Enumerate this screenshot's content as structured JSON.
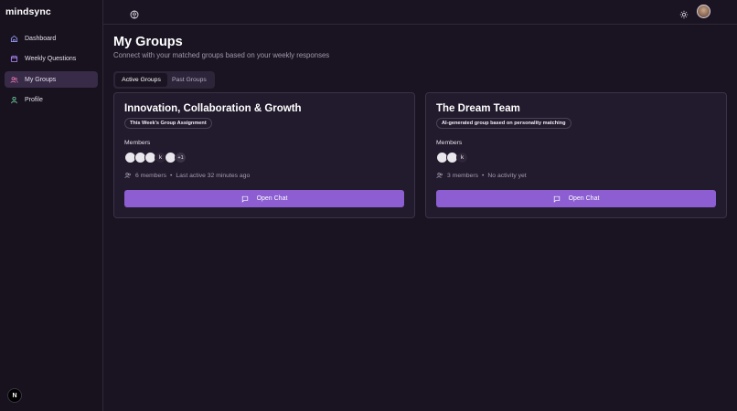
{
  "app": {
    "logo": "mindsync",
    "framework_badge": "N"
  },
  "sidebar": {
    "items": [
      {
        "label": "Dashboard",
        "icon": "home-icon",
        "active": false
      },
      {
        "label": "Weekly Questions",
        "icon": "calendar-icon",
        "active": false
      },
      {
        "label": "My Groups",
        "icon": "users-icon",
        "active": true
      },
      {
        "label": "Profile",
        "icon": "user-icon",
        "active": false
      }
    ]
  },
  "header": {
    "left_icon": "brain-icon",
    "theme_icon": "sun-icon",
    "avatar": "user-avatar"
  },
  "main": {
    "title": "My Groups",
    "subtitle": "Connect with your matched groups based on your weekly responses",
    "tabs": [
      {
        "label": "Active Groups",
        "active": true
      },
      {
        "label": "Past Groups",
        "active": false
      }
    ]
  },
  "groups": [
    {
      "name": "Innovation, Collaboration & Growth",
      "badge": "This Week's Group Assignment",
      "members_label": "Members",
      "avatars": [
        "",
        "",
        "",
        "k",
        ""
      ],
      "more": "+1",
      "members_count": "6 members",
      "activity": "Last active 32 minutes ago",
      "button": "Open Chat"
    },
    {
      "name": "The Dream Team",
      "badge": "AI-generated group based on personality matching",
      "members_label": "Members",
      "avatars": [
        "",
        "",
        "k"
      ],
      "more": "",
      "members_count": "3 members",
      "activity": "No activity yet",
      "button": "Open Chat"
    }
  ],
  "colors": {
    "accent": "#8c5ed2",
    "background": "#1a1422",
    "card": "#221a2d",
    "active_nav": "#372b47"
  }
}
